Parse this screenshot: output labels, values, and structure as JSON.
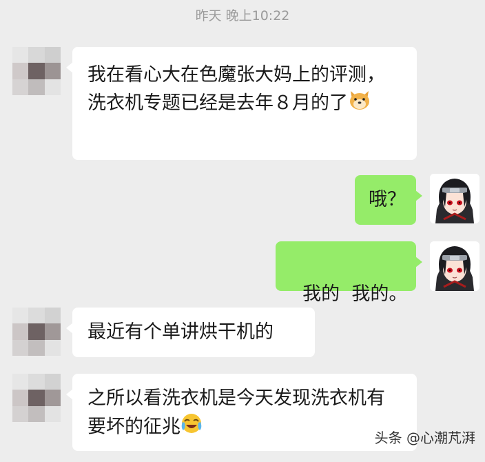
{
  "timestamp": "昨天 晚上10:22",
  "messages": [
    {
      "text": "我在看心大在色魔张大妈上的评测，洗衣机专题已经是去年８月的了",
      "emoji": "doge-emoji"
    },
    {
      "text": "哦？"
    },
    {
      "text": "我的  我的。"
    },
    {
      "text": "最近有个单讲烘干机的"
    },
    {
      "text": "之所以看洗衣机是今天发现洗衣机有要坏的征兆",
      "emoji": "crying-laughing-emoji"
    }
  ],
  "watermark": "头条 @心潮芃湃",
  "colors": {
    "background": "#ededed",
    "incoming_bubble": "#ffffff",
    "outgoing_bubble": "#95ec69"
  }
}
